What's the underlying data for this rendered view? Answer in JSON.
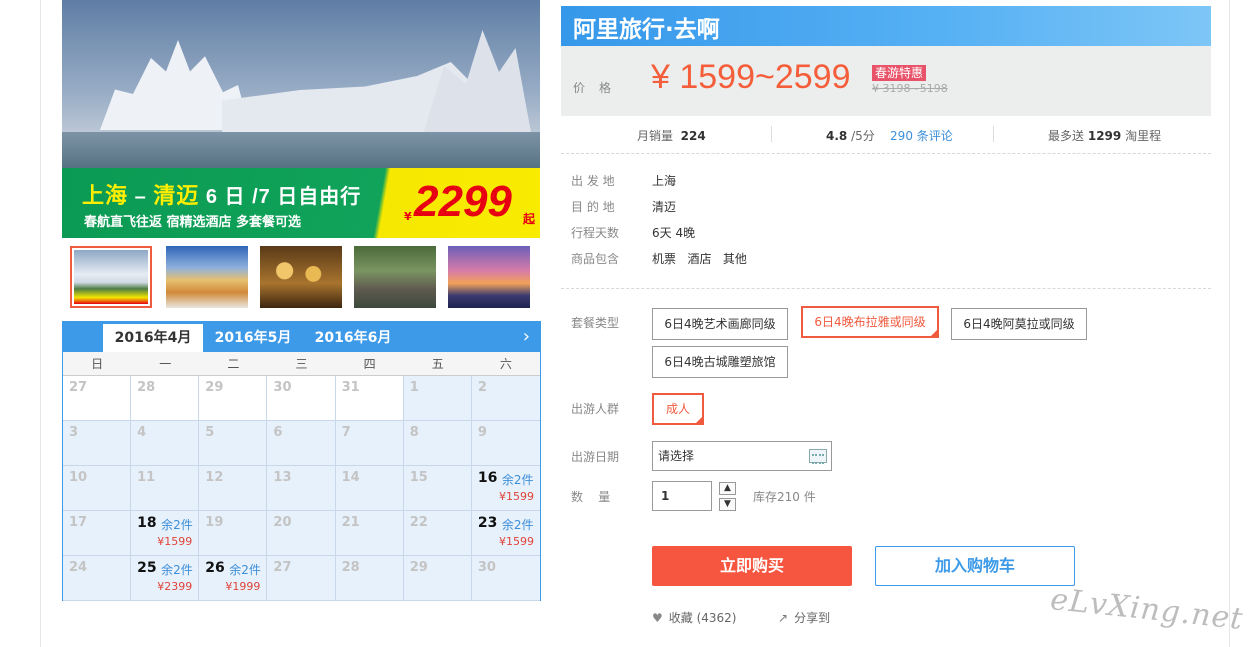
{
  "hero": {
    "title_a": "上海",
    "title_dash": " – ",
    "title_b": "清迈",
    "title_days": " 6 日 /7 日自由行",
    "subtitle": "春航直飞往返 宿精选酒店 多套餐可选",
    "yen": "¥",
    "price": "2299",
    "qi": "起"
  },
  "thumbs": [
    "temple-white",
    "temple-gold",
    "buddha-statues",
    "elephant-ride",
    "chiangmai-sunset"
  ],
  "calendar": {
    "tabs": [
      "2016年4月",
      "2016年5月",
      "2016年6月"
    ],
    "next": "›",
    "weekdays": [
      "日",
      "一",
      "二",
      "三",
      "四",
      "五",
      "六"
    ],
    "cells": [
      {
        "d": "27",
        "gray": true
      },
      {
        "d": "28",
        "gray": true
      },
      {
        "d": "29",
        "gray": true
      },
      {
        "d": "30",
        "gray": true
      },
      {
        "d": "31",
        "gray": true
      },
      {
        "d": "1"
      },
      {
        "d": "2"
      },
      {
        "d": "3"
      },
      {
        "d": "4"
      },
      {
        "d": "5"
      },
      {
        "d": "6"
      },
      {
        "d": "7"
      },
      {
        "d": "8"
      },
      {
        "d": "9"
      },
      {
        "d": "10"
      },
      {
        "d": "11"
      },
      {
        "d": "12"
      },
      {
        "d": "13"
      },
      {
        "d": "14"
      },
      {
        "d": "15"
      },
      {
        "d": "16",
        "left": "余2件",
        "price": "¥1599"
      },
      {
        "d": "17"
      },
      {
        "d": "18",
        "left": "余2件",
        "price": "¥1599"
      },
      {
        "d": "19"
      },
      {
        "d": "20"
      },
      {
        "d": "21"
      },
      {
        "d": "22"
      },
      {
        "d": "23",
        "left": "余2件",
        "price": "¥1599"
      },
      {
        "d": "24"
      },
      {
        "d": "25",
        "left": "余2件",
        "price": "¥2399"
      },
      {
        "d": "26",
        "left": "余2件",
        "price": "¥1999"
      },
      {
        "d": "27"
      },
      {
        "d": "28"
      },
      {
        "d": "29"
      },
      {
        "d": "30"
      }
    ]
  },
  "product": {
    "title": "阿里旅行·去啊",
    "price_label": "价格",
    "price": "¥ 1599~2599",
    "promo": "春游特惠",
    "original": "¥ 3198~5198",
    "monthly_sales_label": "月销量",
    "monthly_sales": "224",
    "rating": "4.8",
    "rating_suffix": "/5分",
    "reviews": "290 条评论",
    "points_label": "最多送",
    "points": "1299",
    "points_suffix": "淘里程"
  },
  "info": [
    {
      "k": "出 发 地",
      "v": "上海"
    },
    {
      "k": "目 的 地",
      "v": "清迈"
    },
    {
      "k": "行程天数",
      "v": "6天 4晚"
    },
    {
      "k": "商品包含",
      "v": "机票   酒店   其他"
    }
  ],
  "form": {
    "package_label": "套餐类型",
    "packages": [
      "6日4晚艺术画廊同级",
      "6日4晚布拉雅或同级",
      "6日4晚阿莫拉或同级",
      "6日4晚古城雕塑旅馆"
    ],
    "crowd_label": "出游人群",
    "crowd": "成人",
    "date_label": "出游日期",
    "date_placeholder": "请选择",
    "qty_label": "数    量",
    "qty": "1",
    "stock": "库存210 件",
    "buy": "立即购买",
    "cart": "加入购物车",
    "fav": "收藏 (4362)",
    "share": "分享到"
  },
  "watermark": "eLvXing.net",
  "colors": {
    "accent": "#3d9ae8",
    "price": "#f55e3a",
    "buy": "#f6553f",
    "selected": "#f05a3e"
  }
}
